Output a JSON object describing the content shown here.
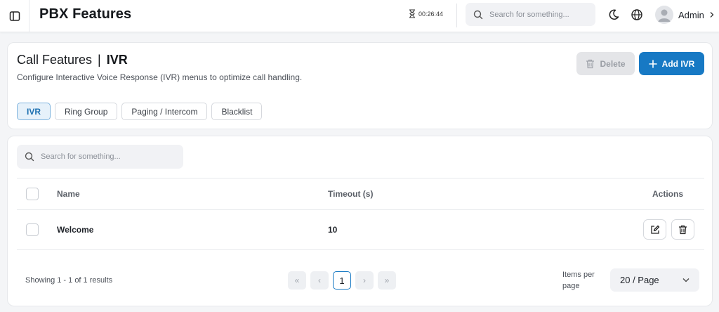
{
  "header": {
    "title": "PBX Features",
    "timer": "00:26:44",
    "search_placeholder": "Search for something...",
    "user_name": "Admin"
  },
  "page": {
    "crumb_parent": "Call Features",
    "crumb_separator": "|",
    "crumb_current": "IVR",
    "description": "Configure Interactive Voice Response (IVR) menus to optimize call handling.",
    "delete_label": "Delete",
    "add_label": "Add IVR",
    "tabs": [
      {
        "label": "IVR",
        "active": true
      },
      {
        "label": "Ring Group",
        "active": false
      },
      {
        "label": "Paging / Intercom",
        "active": false
      },
      {
        "label": "Blacklist",
        "active": false
      }
    ]
  },
  "table": {
    "search_placeholder": "Search for something...",
    "columns": {
      "name": "Name",
      "timeout": "Timeout (s)",
      "actions": "Actions"
    },
    "rows": [
      {
        "name": "Welcome",
        "timeout": "10"
      }
    ]
  },
  "pagination": {
    "showing_text": "Showing 1 - 1 of 1 results",
    "first": "«",
    "prev": "‹",
    "current_page": "1",
    "next": "›",
    "last": "»",
    "items_per_page_label": "Items per page",
    "page_size": "20 / Page"
  },
  "colors": {
    "primary": "#1779c4",
    "active_tab_bg": "#e6f1fa",
    "disabled_button": "#e4e5e8"
  },
  "icons": [
    "sidebar-toggle-icon",
    "hourglass-icon",
    "search-icon",
    "moon-icon",
    "globe-icon",
    "user-avatar-icon",
    "chevron-right-icon",
    "trash-icon",
    "plus-icon",
    "edit-icon",
    "chevron-down-icon"
  ]
}
